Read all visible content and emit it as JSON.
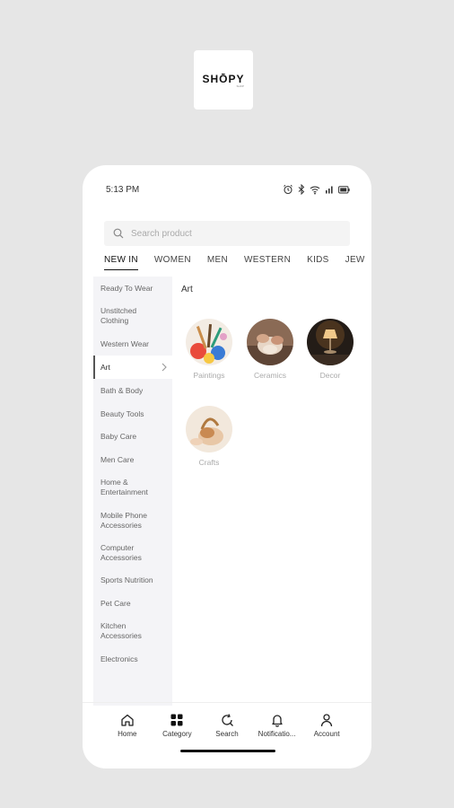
{
  "brand": {
    "name": "SHŌPY",
    "sub": "SHOP"
  },
  "status_bar": {
    "time": "5:13 PM"
  },
  "search": {
    "placeholder": "Search product"
  },
  "tabs": [
    "NEW IN",
    "WOMEN",
    "MEN",
    "WESTERN",
    "KIDS",
    "JEW"
  ],
  "sidebar": {
    "items": [
      "Ready To Wear",
      "Unstitched Clothing",
      "Western Wear",
      "Art",
      "Bath & Body",
      "Beauty Tools",
      "Baby Care",
      "Men Care",
      "Home & Entertainment",
      "Mobile Phone Accessories",
      "Computer Accessories",
      "Sports Nutrition",
      "Pet Care",
      "Kitchen Accessories",
      "Electronics"
    ],
    "active": "Art"
  },
  "content": {
    "title": "Art",
    "categories": [
      {
        "label": "Paintings",
        "icon": "paintings-thumbnail"
      },
      {
        "label": "Ceramics",
        "icon": "ceramics-thumbnail"
      },
      {
        "label": "Decor",
        "icon": "decor-lamp-thumbnail"
      },
      {
        "label": "Crafts",
        "icon": "crafts-thumbnail"
      }
    ]
  },
  "bottom_nav": {
    "items": [
      {
        "label": "Home",
        "icon": "home-icon"
      },
      {
        "label": "Category",
        "icon": "grid-icon"
      },
      {
        "label": "Search",
        "icon": "search-refresh-icon"
      },
      {
        "label": "Notificatio...",
        "icon": "bell-icon"
      },
      {
        "label": "Account",
        "icon": "user-icon"
      }
    ]
  }
}
